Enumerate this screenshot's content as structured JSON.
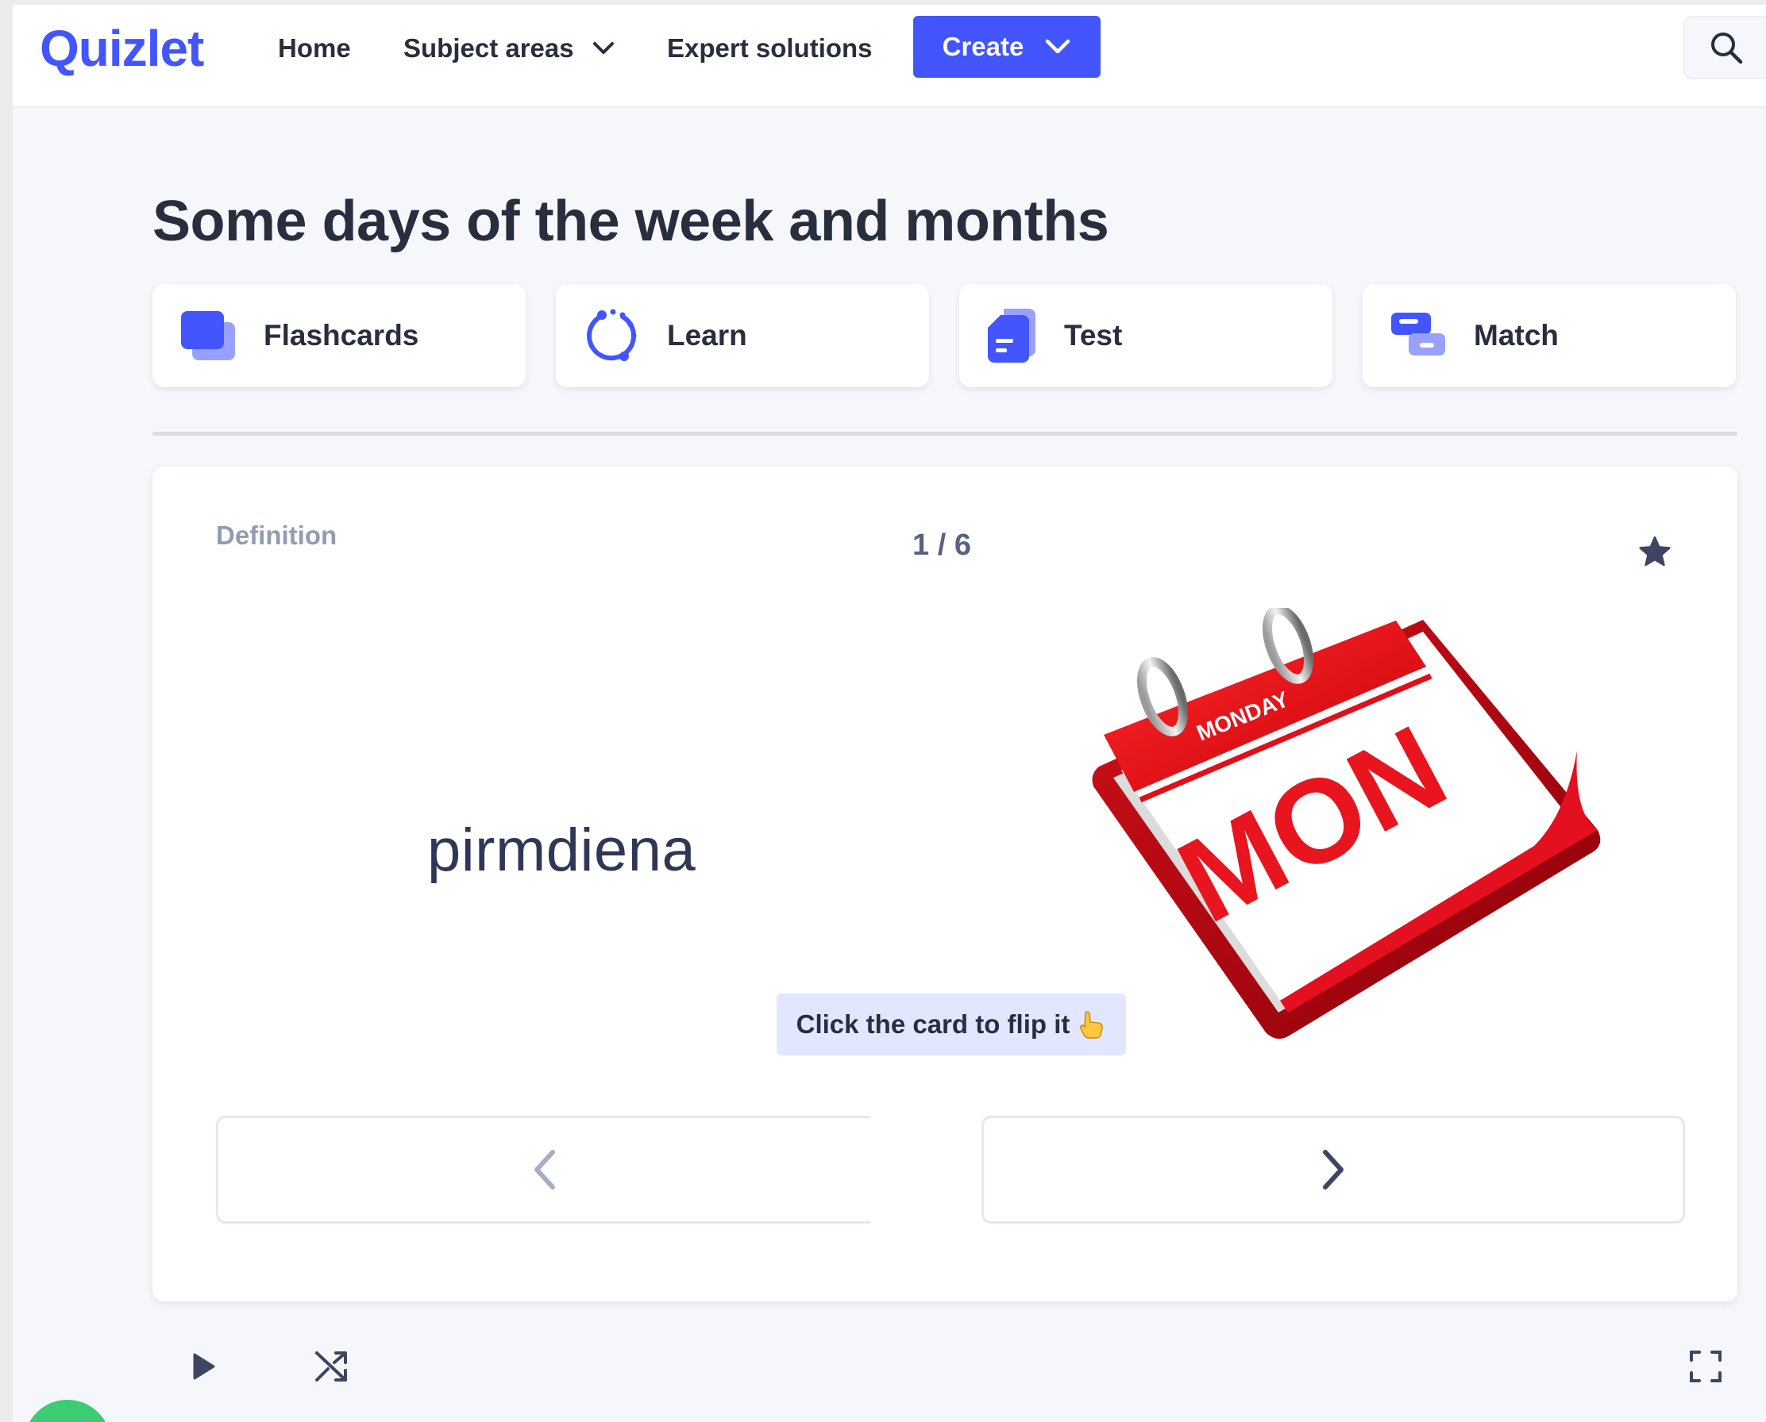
{
  "header": {
    "logo": "Quizlet",
    "nav": {
      "home": "Home",
      "subject_areas": "Subject areas",
      "expert_solutions": "Expert solutions"
    },
    "create_label": "Create"
  },
  "set": {
    "title": "Some days of the week and months"
  },
  "modes": [
    {
      "label": "Flashcards",
      "icon": "flashcards-icon"
    },
    {
      "label": "Learn",
      "icon": "learn-icon"
    },
    {
      "label": "Test",
      "icon": "test-icon"
    },
    {
      "label": "Match",
      "icon": "match-icon"
    }
  ],
  "card": {
    "side_label": "Definition",
    "counter": "1 / 6",
    "term": "pirmdiena",
    "image": {
      "top_text": "MONDAY",
      "big_text": "MON"
    },
    "hint": "Click the card to flip it"
  },
  "colors": {
    "brand": "#4255ff",
    "text": "#282e3e",
    "muted": "#939bb4",
    "hint_bg": "#e3e6ff"
  },
  "controls": {
    "play": "play-icon",
    "shuffle": "shuffle-icon",
    "fullscreen": "fullscreen-icon"
  }
}
